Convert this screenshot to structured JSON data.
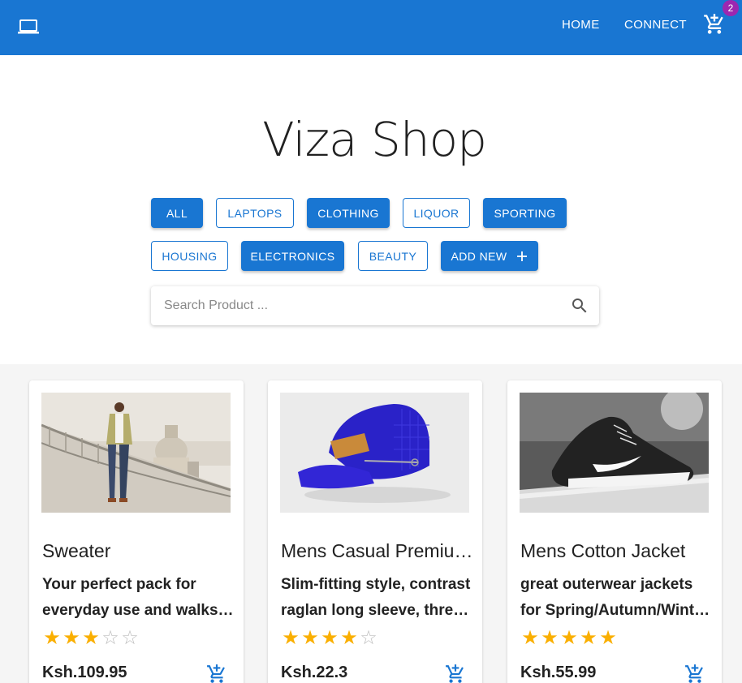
{
  "appbar": {
    "logo_icon": "laptop-icon",
    "nav": [
      {
        "label": "HOME"
      },
      {
        "label": "CONNECT"
      }
    ],
    "cart_icon": "add-shopping-cart-icon",
    "cart_count": "2",
    "color": "#1976d2",
    "badge_color": "#9c27b0"
  },
  "hero": {
    "title": "Viza Shop"
  },
  "filters": {
    "row1": [
      {
        "label": "ALL",
        "style": "filled"
      },
      {
        "label": "LAPTOPS",
        "style": "outlined"
      },
      {
        "label": "CLOTHING",
        "style": "filled"
      },
      {
        "label": "LIQUOR",
        "style": "outlined"
      },
      {
        "label": "SPORTING",
        "style": "filled"
      }
    ],
    "row2": [
      {
        "label": "HOUSING",
        "style": "outlined"
      },
      {
        "label": "ELECTRONICS",
        "style": "filled"
      },
      {
        "label": "BEAUTY",
        "style": "outlined"
      },
      {
        "label": "ADD NEW",
        "style": "filled",
        "icon": "plus-icon"
      }
    ]
  },
  "search": {
    "placeholder": "Search Product ...",
    "value": "",
    "icon": "search-icon"
  },
  "products": [
    {
      "name": "Sweater",
      "description": "Your perfect pack for everyday use and walks in the forest.",
      "rating": 3,
      "price": "Ksh.109.95",
      "image": "man-on-bridge-photo"
    },
    {
      "name": "Mens Casual Premium Slim Fit T-Shirts",
      "description": "Slim-fitting style, contrast raglan long sleeve, three-button henley placket.",
      "rating": 4,
      "price": "Ksh.22.3",
      "image": "blue-cap-photo"
    },
    {
      "name": "Mens Cotton Jacket",
      "description": "great outerwear jackets for Spring/Autumn/Winter, suitable for many occasions.",
      "rating": 5,
      "price": "Ksh.55.99",
      "image": "black-sneaker-photo"
    }
  ]
}
